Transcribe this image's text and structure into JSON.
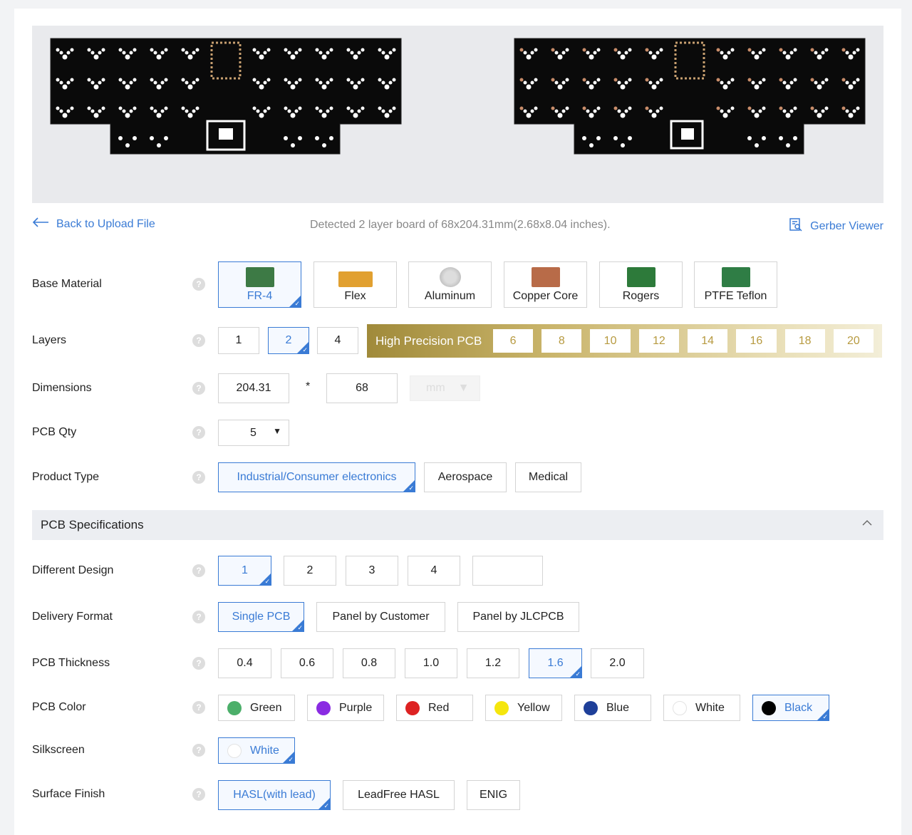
{
  "top": {
    "back_label": "Back to Upload File",
    "detected_text": "Detected 2 layer board of 68x204.31mm(2.68x8.04 inches).",
    "gerber_label": "Gerber Viewer"
  },
  "base_material": {
    "label": "Base Material",
    "options": [
      "FR-4",
      "Flex",
      "Aluminum",
      "Copper Core",
      "Rogers",
      "PTFE Teflon"
    ],
    "selected": "FR-4"
  },
  "layers": {
    "label": "Layers",
    "options": [
      "1",
      "2",
      "4"
    ],
    "selected": "2",
    "high_precision_label": "High Precision PCB",
    "high_precision_options": [
      "6",
      "8",
      "10",
      "12",
      "14",
      "16",
      "18",
      "20"
    ]
  },
  "dimensions": {
    "label": "Dimensions",
    "length": "204.31",
    "times": "*",
    "width": "68",
    "unit": "mm"
  },
  "qty": {
    "label": "PCB Qty",
    "value": "5"
  },
  "product_type": {
    "label": "Product Type",
    "options": [
      "Industrial/Consumer electronics",
      "Aerospace",
      "Medical"
    ],
    "selected": "Industrial/Consumer electronics"
  },
  "specs": {
    "title": "PCB Specifications"
  },
  "different_design": {
    "label": "Different Design",
    "options": [
      "1",
      "2",
      "3",
      "4"
    ],
    "selected": "1"
  },
  "delivery_format": {
    "label": "Delivery Format",
    "options": [
      "Single PCB",
      "Panel by Customer",
      "Panel by JLCPCB"
    ],
    "selected": "Single PCB"
  },
  "thickness": {
    "label": "PCB Thickness",
    "options": [
      "0.4",
      "0.6",
      "0.8",
      "1.0",
      "1.2",
      "1.6",
      "2.0"
    ],
    "selected": "1.6"
  },
  "pcb_color": {
    "label": "PCB Color",
    "options": [
      {
        "name": "Green",
        "color": "#4caf6a"
      },
      {
        "name": "Purple",
        "color": "#8a2be2"
      },
      {
        "name": "Red",
        "color": "#dd2222"
      },
      {
        "name": "Yellow",
        "color": "#f5e60d"
      },
      {
        "name": "Blue",
        "color": "#1e3f99"
      },
      {
        "name": "White",
        "color": "#ffffff"
      },
      {
        "name": "Black",
        "color": "#000000"
      }
    ],
    "selected": "Black"
  },
  "silkscreen": {
    "label": "Silkscreen",
    "value": "White"
  },
  "surface_finish": {
    "label": "Surface Finish",
    "options": [
      "HASL(with lead)",
      "LeadFree HASL",
      "ENIG"
    ],
    "selected": "HASL(with lead)"
  },
  "help_glyph": "?",
  "colors": {
    "accent": "#3a7bd5",
    "gold": "#b79a40"
  }
}
